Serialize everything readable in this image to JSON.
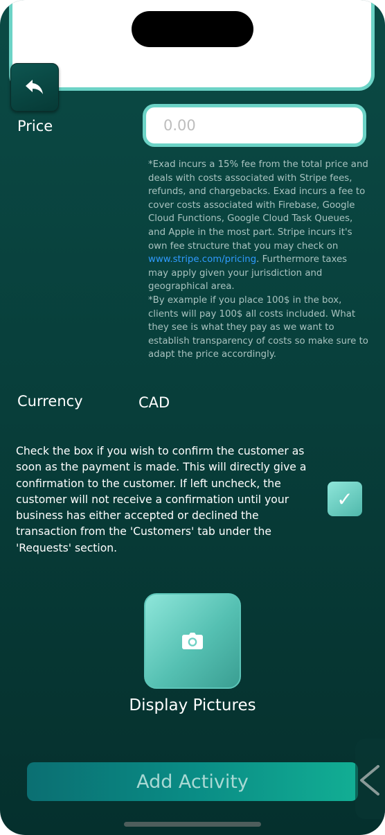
{
  "price": {
    "label": "Price",
    "placeholder": "0.00",
    "note_part1": "*Exad incurs a 15% fee from the total price and deals with costs associated with Stripe fees, refunds, and chargebacks. Exad incurs a fee to cover costs associated with Firebase, Google Cloud Functions, Google Cloud Task Queues, and Apple in the most part. Stripe incurs it's own fee structure that you may check on ",
    "note_link": "www.stripe.com/pricing",
    "note_part2": ". Furthermore taxes may apply given your jurisdiction and geographical area.",
    "note_part3": "*By example if you place 100$ in the box, clients will pay 100$ all costs included. What they see is what they pay as we want to establish transparency of costs so make sure to adapt the price accordingly."
  },
  "currency": {
    "label": "Currency",
    "value": "CAD"
  },
  "confirm": {
    "text": "Check the box if you wish to confirm the customer as soon as the payment is made. This will directly give a confirmation to the customer. If left uncheck, the customer will not receive a confirmation until your business has either accepted or declined the transaction from the 'Customers' tab under the 'Requests' section.",
    "checked": true,
    "check_glyph": "✓"
  },
  "pictures": {
    "label": "Display Pictures"
  },
  "actions": {
    "add_activity": "Add Activity"
  },
  "colors": {
    "accent": "#6cd3c6",
    "background": "#083f3b",
    "link": "#2f9bff"
  }
}
